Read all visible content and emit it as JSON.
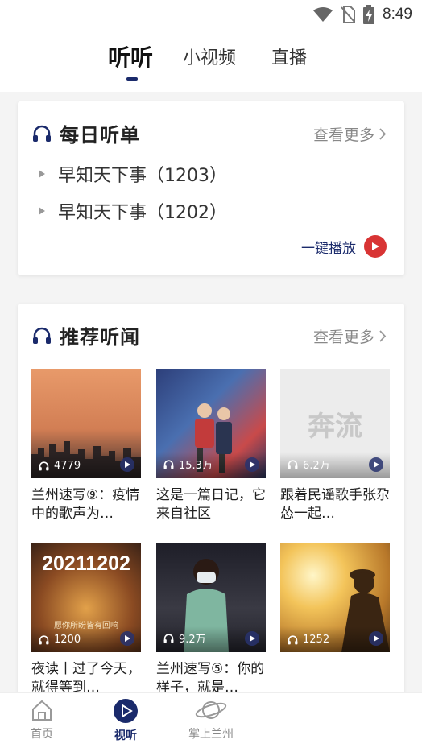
{
  "status_bar": {
    "time": "8:49",
    "icons": [
      "wifi-icon",
      "no-sim-icon",
      "battery-charging-icon"
    ]
  },
  "top_tabs": [
    {
      "label": "听听",
      "active": true
    },
    {
      "label": "小视频",
      "active": false
    },
    {
      "label": "直播",
      "active": false
    }
  ],
  "daily": {
    "title": "每日听单",
    "more": "查看更多",
    "items": [
      {
        "label": "早知天下事（1203）"
      },
      {
        "label": "早知天下事（1202）"
      }
    ],
    "play_all": "一键播放"
  },
  "recommended": {
    "title": "推荐听闻",
    "more": "查看更多",
    "items": [
      {
        "count": "4779",
        "title": "兰州速写⑨：疫情中的歌声为…"
      },
      {
        "count": "15.3万",
        "title": "这是一篇日记，它来自社区"
      },
      {
        "count": "6.2万",
        "title": "跟着民谣歌手张尕怂一起…",
        "image_text": "奔流"
      },
      {
        "count": "1200",
        "title": "夜读丨过了今天，就得等到…",
        "image_text": "20211202",
        "image_caption": "愿你所盼皆有回响"
      },
      {
        "count": "9.2万",
        "title": "兰州速写⑤：你的样子，就是…"
      },
      {
        "count": "1252",
        "title": ""
      }
    ]
  },
  "bottom_nav": [
    {
      "label": "首页",
      "icon": "home-icon",
      "active": false
    },
    {
      "label": "视听",
      "icon": "play-icon",
      "active": true
    },
    {
      "label": "掌上兰州",
      "icon": "planet-icon",
      "active": false
    }
  ],
  "colors": {
    "accent": "#1a2a6b",
    "play_red": "#d83434"
  }
}
